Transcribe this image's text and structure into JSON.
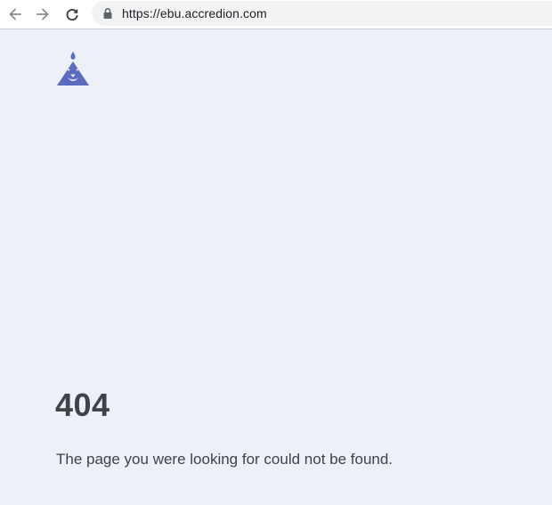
{
  "browser": {
    "url": "https://ebu.accredion.com",
    "icons": {
      "back": "arrow-left-icon",
      "forward": "arrow-right-icon",
      "reload": "reload-icon",
      "secure": "lock-icon"
    }
  },
  "page": {
    "logo_icon": "accredion-lion-logo",
    "brand_color": "#5b6bbf",
    "error_code": "404",
    "error_message": "The page you were looking for could not be found."
  }
}
